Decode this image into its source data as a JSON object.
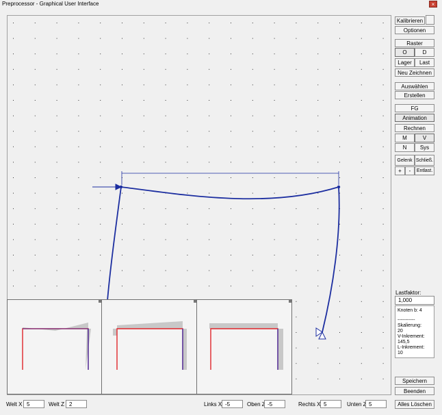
{
  "window": {
    "title": "Preprocessor - Graphical User Interface",
    "close_glyph": "×"
  },
  "right_panel": {
    "kalibrieren": "Kalibrieren",
    "optionen": "Optionen",
    "raster": "Raster",
    "o": "O",
    "d": "D",
    "lager": "Lager",
    "last": "Last",
    "neu_zeichnen": "Neu Zeichnen",
    "auswaehlen": "Auswählen",
    "erstellen": "Erstellen",
    "fg_nummerieren": "FG Nummerieren",
    "animation": "Animation",
    "rechnen": "Rechnen",
    "m": "M",
    "v": "V",
    "n": "N",
    "sys": "Sys",
    "gelenk": "Gelenk",
    "schliess": "Schließ.",
    "plus": "+",
    "minus": "-",
    "entlast": "Entlast.",
    "lastfaktor_label": "Lastfaktor:",
    "lastfaktor_value": "1,000",
    "info": {
      "knoten": "Knoten b: 4",
      "sep": "-----------",
      "skal_label": "Skalierung:",
      "skal_value": "20",
      "vinc_label": "V-Inkrement:",
      "vinc_value": "145,5",
      "linc_label": "L-Inkrement:",
      "linc_value": "10"
    },
    "speichern": "Speichern",
    "beenden": "Beenden",
    "alles_loeschen": "Alles Löschen"
  },
  "status_bar": {
    "welt_x_label": "Welt X",
    "welt_x_value": "5",
    "welt_z_label": "Welt Z",
    "welt_z_value": "2",
    "links_x_label": "Links X",
    "links_x_value": "-5",
    "oben_z_label": "Oben Z",
    "oben_z_value": "-5",
    "rechts_x_label": "Rechts X",
    "rechts_x_value": "5",
    "unten_z_label": "Unten Z",
    "unten_z_value": "5"
  },
  "colors": {
    "structure": "#1c2ea0",
    "red": "#e0242a",
    "blue": "#2b2bb0",
    "gray": "#c8c8c8"
  }
}
